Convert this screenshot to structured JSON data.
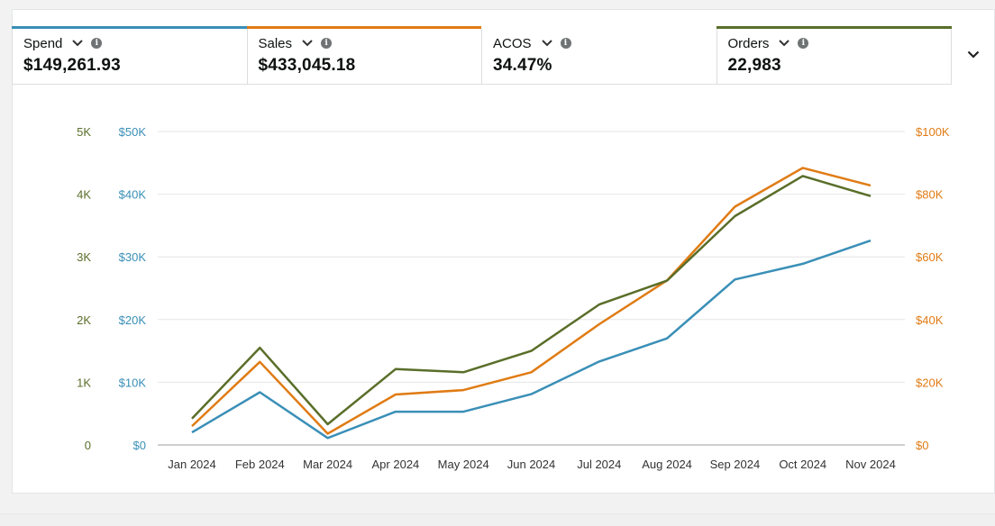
{
  "metrics": [
    {
      "label": "Spend",
      "value": "$149,261.93",
      "color": "#3a8fb7",
      "selected": true
    },
    {
      "label": "Sales",
      "value": "$433,045.18",
      "color": "#e07b14",
      "selected": true
    },
    {
      "label": "ACOS",
      "value": "34.47%",
      "color": "#ffffff",
      "selected": false
    },
    {
      "label": "Orders",
      "value": "22,983",
      "color": "#5a6e29",
      "selected": true
    }
  ],
  "icons": {
    "dropdown": "chevron-down-icon",
    "info": "info-icon",
    "expand": "chevron-down-icon"
  },
  "chart_data": {
    "type": "line",
    "categories": [
      "Jan 2024",
      "Feb 2024",
      "Mar 2024",
      "Apr 2024",
      "May 2024",
      "Jun 2024",
      "Jul 2024",
      "Aug 2024",
      "Sep 2024",
      "Oct 2024",
      "Nov 2024"
    ],
    "axes": {
      "left_outer": {
        "series": "Orders",
        "ylim": [
          0,
          5000
        ],
        "ticks": [
          "0",
          "1K",
          "2K",
          "3K",
          "4K",
          "5K"
        ],
        "color": "#5a6e29"
      },
      "left_inner": {
        "series": "Spend",
        "ylim": [
          0,
          50000
        ],
        "ticks": [
          "$0",
          "$10K",
          "$20K",
          "$30K",
          "$40K",
          "$50K"
        ],
        "color": "#3a8fb7"
      },
      "right": {
        "series": "Sales",
        "ylim": [
          0,
          100000
        ],
        "ticks": [
          "$0",
          "$20K",
          "$40K",
          "$60K",
          "$80K",
          "$100K"
        ],
        "color": "#e07b14"
      }
    },
    "series": [
      {
        "name": "Spend",
        "axis": "left_inner",
        "color": "#3a8fb7",
        "values": [
          2000,
          8400,
          1100,
          5300,
          5300,
          8100,
          13300,
          17000,
          26400,
          28900,
          32600
        ]
      },
      {
        "name": "Sales",
        "axis": "right",
        "color": "#e07b14",
        "values": [
          6000,
          26500,
          3600,
          16100,
          17500,
          23200,
          38500,
          52500,
          76000,
          88400,
          82800
        ]
      },
      {
        "name": "Orders",
        "axis": "left_outer",
        "color": "#5a6e29",
        "values": [
          420,
          1550,
          330,
          1210,
          1160,
          1500,
          2240,
          2620,
          3650,
          4290,
          3970
        ]
      }
    ],
    "grid": true
  }
}
